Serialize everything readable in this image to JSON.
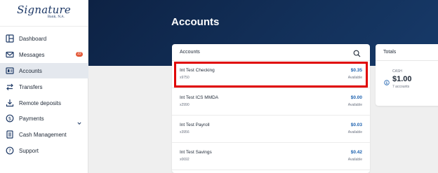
{
  "brand": {
    "name": "Signature",
    "subtitle": "Bank, N.A."
  },
  "nav": {
    "items": [
      {
        "label": "Dashboard",
        "icon": "dashboard-icon"
      },
      {
        "label": "Messages",
        "icon": "mail-icon",
        "badge": "22"
      },
      {
        "label": "Accounts",
        "icon": "accounts-icon",
        "active": true
      },
      {
        "label": "Transfers",
        "icon": "transfer-icon"
      },
      {
        "label": "Remote deposits",
        "icon": "deposit-icon"
      },
      {
        "label": "Payments",
        "icon": "payments-icon",
        "has_submenu": true
      },
      {
        "label": "Cash Management",
        "icon": "cash-management-icon"
      },
      {
        "label": "Support",
        "icon": "support-icon"
      }
    ]
  },
  "page": {
    "title": "Accounts"
  },
  "accounts_panel": {
    "title": "Accounts",
    "rows": [
      {
        "name": "Int Test Checking",
        "number": "x9750",
        "balance": "$0.35",
        "balance_label": "Available"
      },
      {
        "name": "Int Test ICS MMDA",
        "number": "x2990",
        "balance": "$0.00",
        "balance_label": "Available"
      },
      {
        "name": "Int Test Payroll",
        "number": "x3956",
        "balance": "$0.03",
        "balance_label": "Available"
      },
      {
        "name": "Int Test Savings",
        "number": "x0692",
        "balance": "$0.42",
        "balance_label": "Available"
      }
    ]
  },
  "totals_panel": {
    "title": "Totals",
    "cash_label": "CASH",
    "cash_amount": "$1.00",
    "cash_count": "7 accounts"
  },
  "colors": {
    "hero": "#13315b",
    "accent_blue": "#1f63b0",
    "highlight_red": "#e00000",
    "badge": "#e45a3a"
  }
}
